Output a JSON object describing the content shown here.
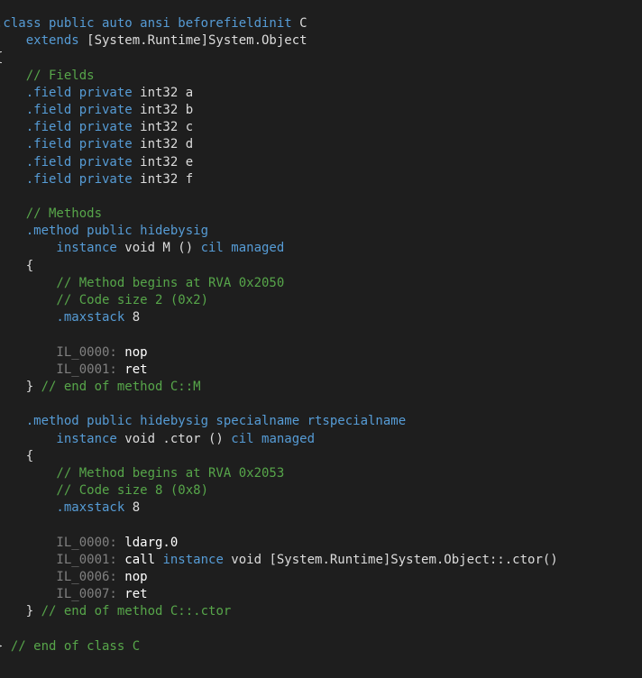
{
  "colors": {
    "background": "#1e1e1e",
    "keyword": "#569cd6",
    "comment": "#57a64a",
    "label": "#808080",
    "text": "#dcdcdc",
    "opcode": "#ffffff"
  },
  "lines": [
    [
      {
        "t": ".class public auto ansi beforefieldinit",
        "c": "kw"
      },
      {
        "t": " C",
        "c": "pl"
      }
    ],
    [
      {
        "t": "    extends",
        "c": "kw"
      },
      {
        "t": " [System.Runtime]System.Object",
        "c": "pl"
      }
    ],
    [
      {
        "t": "{",
        "c": "pl"
      }
    ],
    [
      {
        "t": "    // Fields",
        "c": "cm"
      }
    ],
    [
      {
        "t": "    .field private",
        "c": "kw"
      },
      {
        "t": " int32 a",
        "c": "pl"
      }
    ],
    [
      {
        "t": "    .field private",
        "c": "kw"
      },
      {
        "t": " int32 b",
        "c": "pl"
      }
    ],
    [
      {
        "t": "    .field private",
        "c": "kw"
      },
      {
        "t": " int32 c",
        "c": "pl"
      }
    ],
    [
      {
        "t": "    .field private",
        "c": "kw"
      },
      {
        "t": " int32 d",
        "c": "pl"
      }
    ],
    [
      {
        "t": "    .field private",
        "c": "kw"
      },
      {
        "t": " int32 e",
        "c": "pl"
      }
    ],
    [
      {
        "t": "    .field private",
        "c": "kw"
      },
      {
        "t": " int32 f",
        "c": "pl"
      }
    ],
    [],
    [
      {
        "t": "    // Methods",
        "c": "cm"
      }
    ],
    [
      {
        "t": "    .method public hidebysig",
        "c": "kw"
      }
    ],
    [
      {
        "t": "        instance",
        "c": "kw"
      },
      {
        "t": " void M () ",
        "c": "pl"
      },
      {
        "t": "cil managed",
        "c": "kw"
      }
    ],
    [
      {
        "t": "    {",
        "c": "pl"
      }
    ],
    [
      {
        "t": "        // Method begins at RVA 0x2050",
        "c": "cm"
      }
    ],
    [
      {
        "t": "        // Code size 2 (0x2)",
        "c": "cm"
      }
    ],
    [
      {
        "t": "        .maxstack",
        "c": "kw"
      },
      {
        "t": " 8",
        "c": "pl"
      }
    ],
    [],
    [
      {
        "t": "        IL_0000:",
        "c": "lbl"
      },
      {
        "t": " nop",
        "c": "op"
      }
    ],
    [
      {
        "t": "        IL_0001:",
        "c": "lbl"
      },
      {
        "t": " ret",
        "c": "op"
      }
    ],
    [
      {
        "t": "    } ",
        "c": "pl"
      },
      {
        "t": "// end of method C::M",
        "c": "cm"
      }
    ],
    [],
    [
      {
        "t": "    .method public hidebysig specialname rtspecialname",
        "c": "kw"
      }
    ],
    [
      {
        "t": "        instance",
        "c": "kw"
      },
      {
        "t": " void .ctor () ",
        "c": "pl"
      },
      {
        "t": "cil managed",
        "c": "kw"
      }
    ],
    [
      {
        "t": "    {",
        "c": "pl"
      }
    ],
    [
      {
        "t": "        // Method begins at RVA 0x2053",
        "c": "cm"
      }
    ],
    [
      {
        "t": "        // Code size 8 (0x8)",
        "c": "cm"
      }
    ],
    [
      {
        "t": "        .maxstack",
        "c": "kw"
      },
      {
        "t": " 8",
        "c": "pl"
      }
    ],
    [],
    [
      {
        "t": "        IL_0000:",
        "c": "lbl"
      },
      {
        "t": " ldarg.0",
        "c": "op"
      }
    ],
    [
      {
        "t": "        IL_0001:",
        "c": "lbl"
      },
      {
        "t": " call ",
        "c": "op"
      },
      {
        "t": "instance",
        "c": "kw"
      },
      {
        "t": " void [System.Runtime]System.Object::.ctor()",
        "c": "pl"
      }
    ],
    [
      {
        "t": "        IL_0006:",
        "c": "lbl"
      },
      {
        "t": " nop",
        "c": "op"
      }
    ],
    [
      {
        "t": "        IL_0007:",
        "c": "lbl"
      },
      {
        "t": " ret",
        "c": "op"
      }
    ],
    [
      {
        "t": "    } ",
        "c": "pl"
      },
      {
        "t": "// end of method C::.ctor",
        "c": "cm"
      }
    ],
    [],
    [
      {
        "t": "} ",
        "c": "pl"
      },
      {
        "t": "// end of class C",
        "c": "cm"
      }
    ]
  ]
}
